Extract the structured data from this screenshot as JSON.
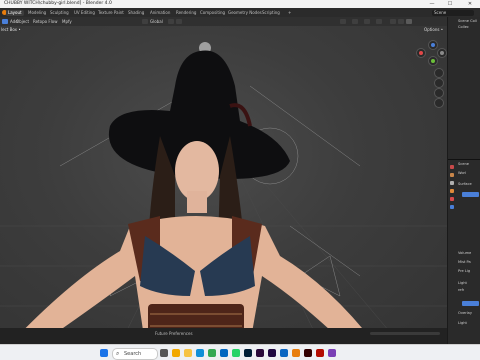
{
  "window": {
    "title": "CHUBBY WITCH\\chubby-girl.blend] - Blender 4.0",
    "controls": {
      "minimize": "—",
      "maximize": "☐",
      "close": "✕"
    }
  },
  "workspaces": [
    "Layout",
    "Modeling",
    "Sculpting",
    "UV Editing",
    "Texture Paint",
    "Shading",
    "Animation",
    "Rendering",
    "Compositing",
    "Geometry Nodes",
    "Scripting"
  ],
  "add_workspace": "+",
  "scene_label": "Scene",
  "viewport_header": {
    "select_box": "lect Box •",
    "menu": [
      "Add",
      "Object",
      "Retopo Flow",
      "Mpfy"
    ],
    "orientation": "Global",
    "options": "Options •"
  },
  "right_panel": {
    "outliner_rows": [
      "Scene Coll",
      "Collec"
    ],
    "props_rows": [
      "Scene",
      "Worl",
      "Surface",
      "Volume",
      "Mist Pa",
      "Pre Lig",
      "Light",
      "refr",
      "Overlay",
      "Light"
    ],
    "collapsed_sections": [
      "Volume",
      "Mist Pa",
      "Pre Lig"
    ]
  },
  "status_bar": {
    "preferences": "Future Preferences"
  },
  "taskbar": {
    "search_placeholder": "Search",
    "apps": [
      {
        "name": "windows-start",
        "color": "#1a73e8"
      },
      {
        "name": "task-view",
        "color": "#555555"
      },
      {
        "name": "widgets",
        "color": "#f2a900"
      },
      {
        "name": "file-explorer",
        "color": "#f6c343"
      },
      {
        "name": "edge",
        "color": "#0f8fd8"
      },
      {
        "name": "chrome",
        "color": "#34a853"
      },
      {
        "name": "mail",
        "color": "#0067c0"
      },
      {
        "name": "whatsapp",
        "color": "#25d366"
      },
      {
        "name": "photoshop",
        "color": "#001e36"
      },
      {
        "name": "premiere",
        "color": "#2a0a3a"
      },
      {
        "name": "after-effects",
        "color": "#1f0740"
      },
      {
        "name": "store",
        "color": "#0a66c2"
      },
      {
        "name": "blender",
        "color": "#e87d0d"
      },
      {
        "name": "illustrator",
        "color": "#330000"
      },
      {
        "name": "acrobat",
        "color": "#b30b00"
      },
      {
        "name": "media",
        "color": "#7a3fb5"
      }
    ]
  },
  "colors": {
    "accent": "#4a7fd8",
    "selection": "#e09040"
  }
}
